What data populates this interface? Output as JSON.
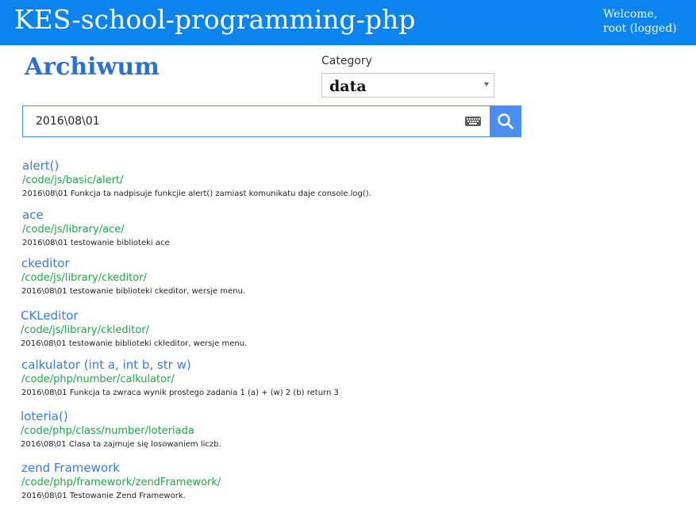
{
  "header": {
    "site_title": "KES-school-programming-php",
    "welcome_line1": "Welcome,",
    "welcome_line2": "root (logged)"
  },
  "page": {
    "title": "Archiwum"
  },
  "category": {
    "label": "Category",
    "selected": "data"
  },
  "search": {
    "value": "2016\\08\\01",
    "keyboard_icon": "keyboard-icon",
    "button_icon": "search-icon"
  },
  "results": [
    {
      "title": "alert()",
      "path": "/code/js/basic/alert/",
      "description": "2016\\08\\01  Funkcja ta nadpisuje funkcjie alert() zamiast komunikatu daje console.log()."
    },
    {
      "title": "ace",
      "path": "/code/js/library/ace/",
      "description": "2016\\08\\01 testowanie biblioteki ace"
    },
    {
      "title": "ckeditor",
      "path": "/code/js/library/ckeditor/",
      "description": "2016\\08\\01 testowanie biblioteki ckeditor, wersje menu."
    },
    {
      "title": "CKLeditor",
      "path": "/code/js/library/ckleditor/",
      "description": "2016\\08\\01 testowanie biblioteki ckleditor, wersje menu."
    },
    {
      "title": "calkulator (int a, int b, str w)",
      "path": "/code/php/number/calkulator/",
      "description": "2016\\08\\01 Funkcja ta zwraca wynik prostego zadania 1 (a) + (w) 2 (b) return 3"
    },
    {
      "title": "loteria()",
      "path": "/code/php/class/number/loteriada",
      "description": "2016\\08\\01 Clasa ta zajmuje się losowaniem liczb."
    },
    {
      "title": "zend Framework",
      "path": "/code/php/framework/zendFramework/",
      "description": "2016\\08\\01 Testowanie Zend Framework."
    }
  ],
  "colors": {
    "header_bg": "#0b84f0",
    "title_blue": "#2a6fd2",
    "link_blue": "#3a7be0",
    "path_green": "#1fa84a",
    "search_button": "#4a8ef0"
  }
}
